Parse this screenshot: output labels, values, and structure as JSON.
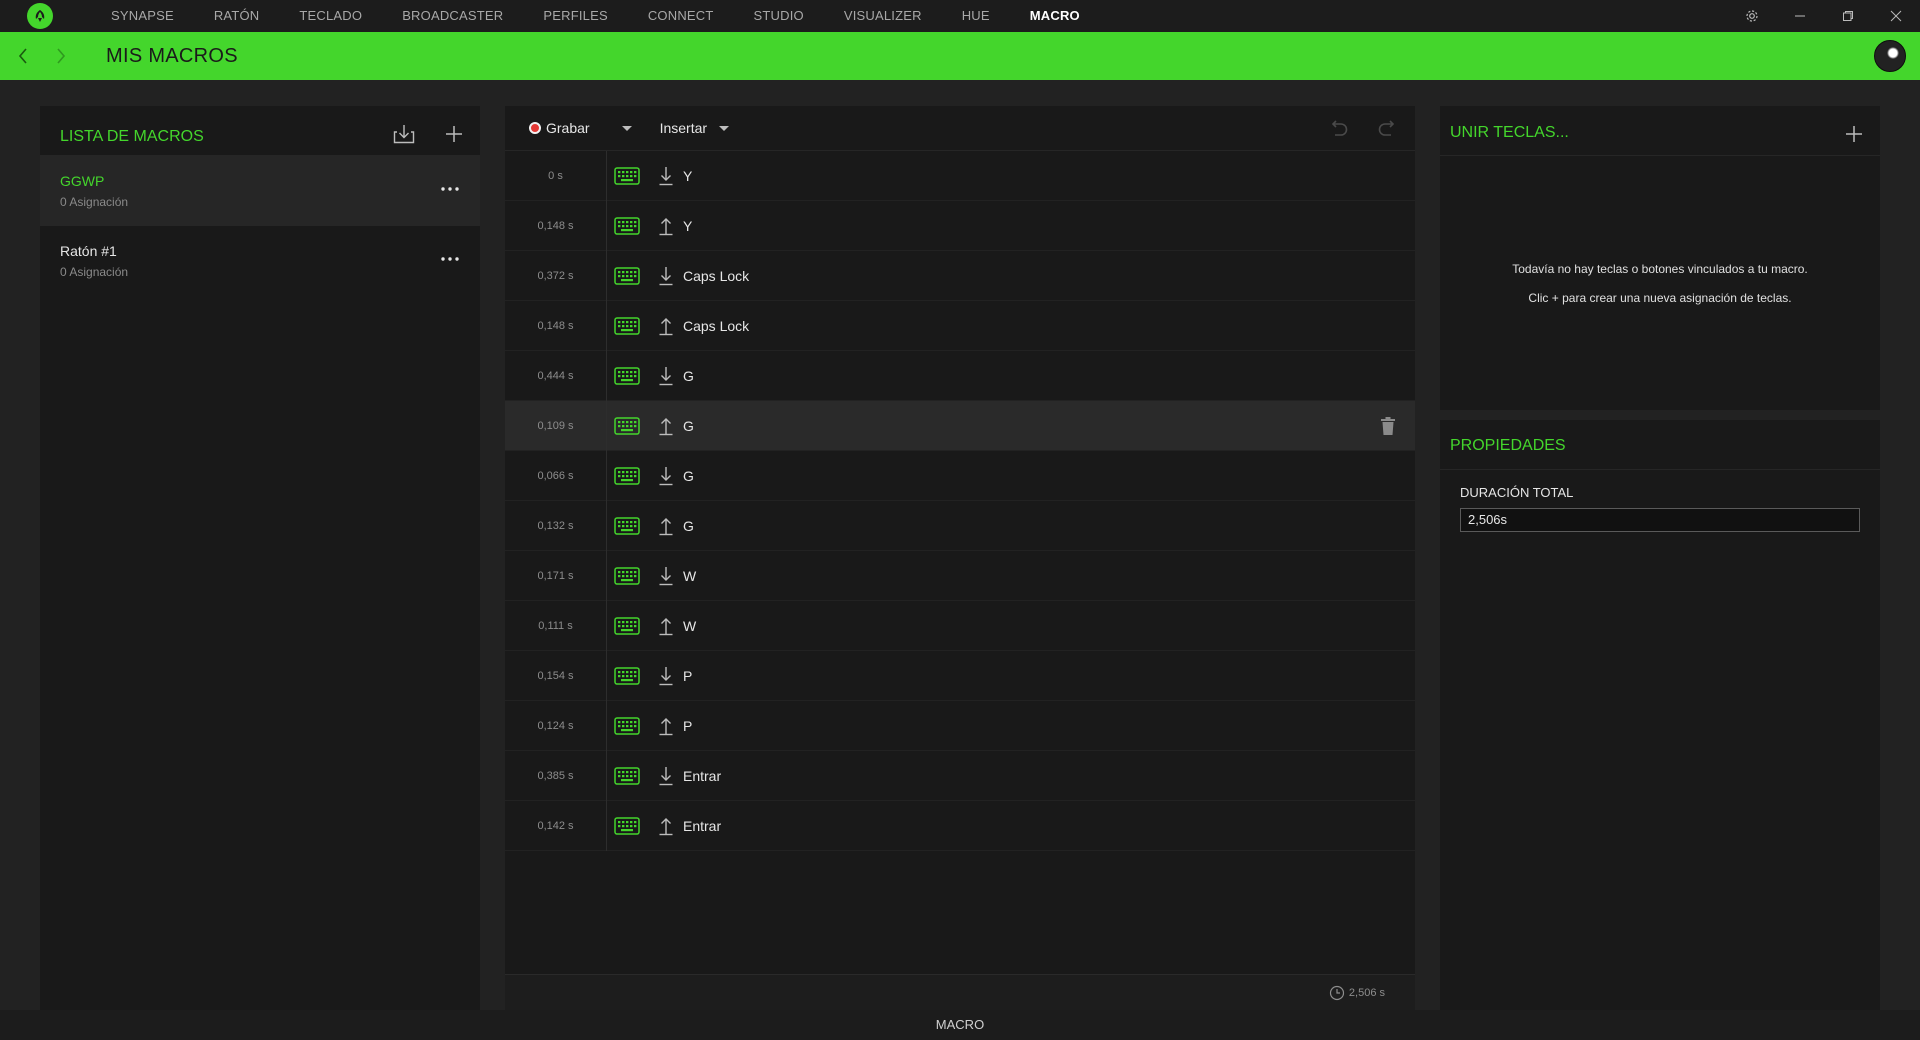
{
  "nav": {
    "tabs": [
      "SYNAPSE",
      "RATÓN",
      "TECLADO",
      "BROADCASTER",
      "PERFILES",
      "CONNECT",
      "STUDIO",
      "VISUALIZER",
      "HUE",
      "MACRO"
    ],
    "active_tab": "MACRO"
  },
  "header": {
    "title": "MIS MACROS"
  },
  "macro_list": {
    "title": "LISTA DE MACROS",
    "items": [
      {
        "name": "GGWP",
        "sub": "0 Asignación",
        "selected": true
      },
      {
        "name": "Ratón #1",
        "sub": "0 Asignación",
        "selected": false
      }
    ]
  },
  "editor": {
    "record_label": "Grabar",
    "insert_label": "Insertar",
    "rows": [
      {
        "time": "0 s",
        "dir": "down",
        "key": "Y"
      },
      {
        "time": "0,148 s",
        "dir": "up",
        "key": "Y"
      },
      {
        "time": "0,372 s",
        "dir": "down",
        "key": "Caps Lock"
      },
      {
        "time": "0,148 s",
        "dir": "up",
        "key": "Caps Lock"
      },
      {
        "time": "0,444 s",
        "dir": "down",
        "key": "G"
      },
      {
        "time": "0,109 s",
        "dir": "up",
        "key": "G",
        "highlight": true
      },
      {
        "time": "0,066 s",
        "dir": "down",
        "key": "G"
      },
      {
        "time": "0,132 s",
        "dir": "up",
        "key": "G"
      },
      {
        "time": "0,171 s",
        "dir": "down",
        "key": "W"
      },
      {
        "time": "0,111 s",
        "dir": "up",
        "key": "W"
      },
      {
        "time": "0,154 s",
        "dir": "down",
        "key": "P"
      },
      {
        "time": "0,124 s",
        "dir": "up",
        "key": "P"
      },
      {
        "time": "0,385 s",
        "dir": "down",
        "key": "Entrar"
      },
      {
        "time": "0,142 s",
        "dir": "up",
        "key": "Entrar"
      }
    ],
    "total_time": "2,506 s"
  },
  "bind": {
    "title": "UNIR TECLAS...",
    "empty_line1": "Todavía no hay teclas o botones vinculados a tu macro.",
    "empty_line2": "Clic + para crear una nueva asignación de teclas."
  },
  "properties": {
    "title": "PROPIEDADES",
    "duration_label": "DURACIÓN TOTAL",
    "duration_value": "2,506s"
  },
  "footer": {
    "label": "MACRO"
  },
  "colors": {
    "accent": "#44d62c",
    "panel": "#191919",
    "background": "#222222"
  }
}
